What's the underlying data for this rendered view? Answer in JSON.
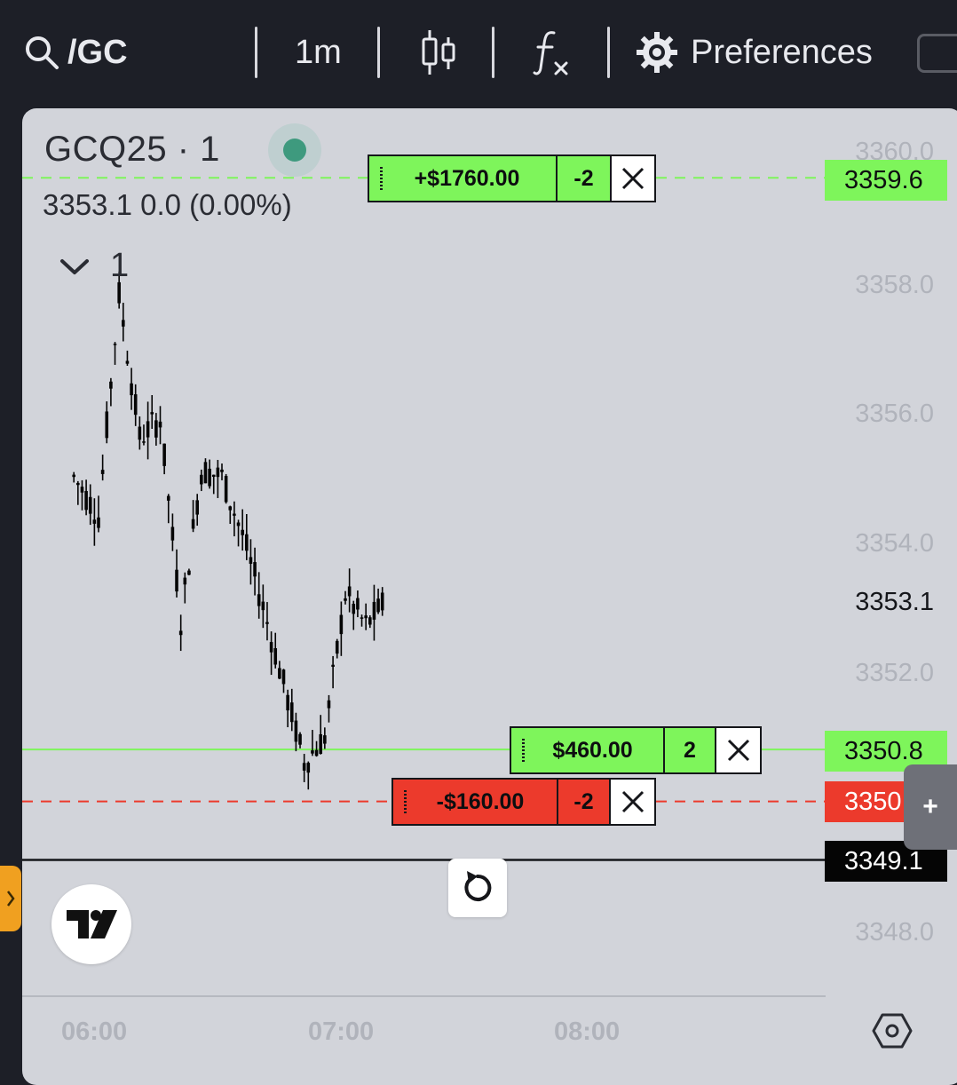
{
  "toolbar": {
    "symbol": "/GC",
    "interval": "1m",
    "preferences_label": "Preferences",
    "icons": [
      "search-icon",
      "candlestick-icon",
      "function-icon",
      "gear-icon"
    ]
  },
  "legend": {
    "title": "GCQ25 · 1",
    "quote": "3353.1  0.0 (0.00%)",
    "collapse_count": "1"
  },
  "y_axis": {
    "ticks": [
      "3360.0",
      "3358.0",
      "3356.0",
      "3354.0",
      "3352.0",
      "3348.0"
    ],
    "current_price": "3353.1"
  },
  "price_tags": {
    "take_profit": "3359.6",
    "position": "3350.8",
    "stop_loss": "3350.",
    "crosshair": "3349.1"
  },
  "orders": {
    "take_profit": {
      "pl": "+$1760.00",
      "qty": "-2"
    },
    "position": {
      "pl": "$460.00",
      "qty": "2"
    },
    "stop_loss": {
      "pl": "-$160.00",
      "qty": "-2"
    }
  },
  "x_axis": {
    "ticks": [
      "06:00",
      "07:00",
      "08:00"
    ]
  },
  "colors": {
    "profit_green": "#7ef55b",
    "loss_red": "#ec3a2c",
    "background": "#d2d4da",
    "toolbar": "#1d1f27"
  },
  "chart_data": {
    "type": "line",
    "series_kind": "candlestick-price",
    "x": [
      "05:54",
      "06:00",
      "06:05",
      "06:10",
      "06:15",
      "06:20",
      "06:25",
      "06:30",
      "06:35",
      "06:40",
      "06:45",
      "06:50",
      "06:55",
      "07:00",
      "07:05",
      "07:10"
    ],
    "values": [
      3355.0,
      3354.4,
      3357.8,
      3355.6,
      3355.9,
      3352.8,
      3355.1,
      3355.0,
      3354.1,
      3353.0,
      3351.8,
      3350.6,
      3351.0,
      3353.2,
      3352.7,
      3353.1
    ],
    "ylim": [
      3347.5,
      3360.4
    ],
    "horizontal_lines": [
      {
        "price": 3359.6,
        "style": "dashed",
        "color": "green"
      },
      {
        "price": 3350.8,
        "style": "solid",
        "color": "green"
      },
      {
        "price": 3350.0,
        "style": "dashed",
        "color": "red"
      },
      {
        "price": 3349.1,
        "style": "solid",
        "color": "black"
      }
    ]
  }
}
